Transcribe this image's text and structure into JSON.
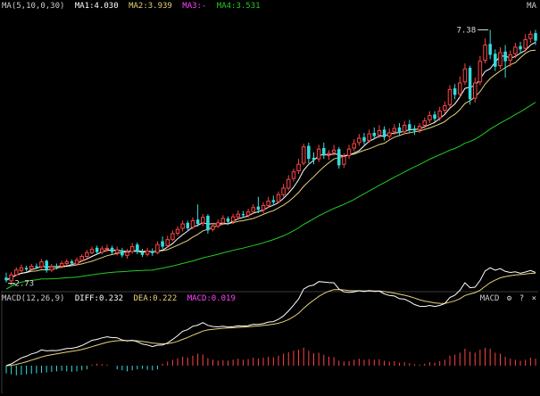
{
  "main_legend": {
    "label": "MA(5,10,0,30)",
    "ma1": "MA1:4.030",
    "ma2": "MA2:3.939",
    "ma3": "MA3:-",
    "ma4": "MA4:3.531",
    "right_tag": "MA"
  },
  "macd_legend": {
    "label": "MACD(12,26,9)",
    "diff": "DIFF:0.232",
    "dea": "DEA:0.222",
    "macd": "MACD:0.019",
    "right_tag": "MACD"
  },
  "colors": {
    "background": "#000000",
    "up": "#ff4444",
    "down": "#33dddd",
    "ma1": "#ffffff",
    "ma2": "#e8d27a",
    "ma3": "#ff44ff",
    "ma4": "#22cc22",
    "diff": "#ffffff",
    "dea": "#e8d27a",
    "macd_label": "#ff44ff",
    "grid": "#333333"
  },
  "icons": [
    "gear-icon",
    "help-icon",
    "close-icon"
  ],
  "chart_data": {
    "type": "candlestick",
    "price_range": [
      2.6,
      7.7
    ],
    "annotations": {
      "high": "7.38",
      "low": "2.73"
    },
    "candles": [
      [
        2.81,
        2.76,
        2.9,
        2.72
      ],
      [
        2.75,
        2.86,
        2.91,
        2.73
      ],
      [
        2.86,
        2.95,
        3.0,
        2.84
      ],
      [
        2.94,
        2.99,
        3.05,
        2.91
      ],
      [
        2.99,
        2.96,
        3.03,
        2.92
      ],
      [
        2.97,
        3.02,
        3.06,
        2.94
      ],
      [
        3.02,
        3.0,
        3.07,
        2.96
      ],
      [
        3.01,
        3.1,
        3.15,
        2.98
      ],
      [
        3.12,
        2.94,
        3.14,
        2.9
      ],
      [
        2.95,
        3.01,
        3.06,
        2.91
      ],
      [
        3.01,
        3.0,
        3.07,
        2.96
      ],
      [
        3.02,
        3.07,
        3.12,
        2.98
      ],
      [
        3.07,
        3.1,
        3.15,
        3.03
      ],
      [
        3.11,
        3.07,
        3.14,
        3.02
      ],
      [
        3.06,
        3.13,
        3.18,
        3.03
      ],
      [
        3.13,
        3.2,
        3.24,
        3.1
      ],
      [
        3.2,
        3.27,
        3.32,
        3.17
      ],
      [
        3.27,
        3.33,
        3.38,
        3.24
      ],
      [
        3.36,
        3.28,
        3.4,
        3.23
      ],
      [
        3.28,
        3.34,
        3.39,
        3.24
      ],
      [
        3.34,
        3.35,
        3.42,
        3.3
      ],
      [
        3.36,
        3.28,
        3.4,
        3.24
      ],
      [
        3.27,
        3.32,
        3.38,
        3.22
      ],
      [
        3.31,
        3.22,
        3.36,
        3.18
      ],
      [
        3.22,
        3.28,
        3.34,
        3.16
      ],
      [
        3.29,
        3.38,
        3.45,
        3.25
      ],
      [
        3.42,
        3.28,
        3.46,
        3.24
      ],
      [
        3.28,
        3.23,
        3.34,
        3.19
      ],
      [
        3.24,
        3.3,
        3.36,
        3.2
      ],
      [
        3.3,
        3.26,
        3.35,
        3.21
      ],
      [
        3.27,
        3.42,
        3.48,
        3.24
      ],
      [
        3.48,
        3.38,
        3.57,
        3.34
      ],
      [
        3.4,
        3.51,
        3.58,
        3.36
      ],
      [
        3.51,
        3.62,
        3.68,
        3.48
      ],
      [
        3.63,
        3.7,
        3.76,
        3.58
      ],
      [
        3.72,
        3.8,
        3.86,
        3.66
      ],
      [
        3.82,
        3.72,
        3.86,
        3.66
      ],
      [
        3.74,
        3.86,
        3.92,
        3.7
      ],
      [
        3.88,
        3.8,
        4.16,
        3.75
      ],
      [
        3.82,
        3.92,
        3.98,
        3.76
      ],
      [
        3.95,
        3.68,
        3.98,
        3.62
      ],
      [
        3.7,
        3.76,
        3.82,
        3.66
      ],
      [
        3.76,
        3.82,
        3.88,
        3.72
      ],
      [
        3.82,
        3.9,
        3.96,
        3.78
      ],
      [
        3.9,
        3.84,
        3.94,
        3.78
      ],
      [
        3.85,
        3.93,
        3.99,
        3.8
      ],
      [
        3.93,
        3.98,
        4.05,
        3.89
      ],
      [
        3.98,
        3.96,
        4.04,
        3.91
      ],
      [
        3.96,
        4.02,
        4.08,
        3.92
      ],
      [
        4.03,
        4.1,
        4.16,
        3.98
      ],
      [
        4.12,
        4.06,
        4.3,
        4.0
      ],
      [
        4.06,
        4.14,
        4.2,
        4.0
      ],
      [
        4.14,
        4.22,
        4.3,
        4.1
      ],
      [
        4.24,
        4.2,
        4.32,
        4.14
      ],
      [
        4.21,
        4.34,
        4.4,
        4.18
      ],
      [
        4.34,
        4.46,
        4.54,
        4.3
      ],
      [
        4.46,
        4.62,
        4.7,
        4.42
      ],
      [
        4.64,
        4.76,
        4.82,
        4.58
      ],
      [
        4.78,
        4.9,
        5.0,
        4.72
      ],
      [
        4.92,
        5.22,
        5.28,
        4.88
      ],
      [
        5.24,
        5.0,
        5.3,
        4.92
      ],
      [
        5.02,
        4.98,
        5.12,
        4.9
      ],
      [
        5.0,
        5.18,
        5.26,
        4.94
      ],
      [
        5.2,
        5.06,
        5.3,
        5.0
      ],
      [
        5.08,
        5.1,
        5.16,
        4.98
      ],
      [
        5.12,
        5.16,
        5.26,
        5.06
      ],
      [
        5.18,
        4.88,
        5.22,
        4.82
      ],
      [
        4.9,
        5.04,
        5.1,
        4.84
      ],
      [
        5.06,
        5.18,
        5.26,
        5.0
      ],
      [
        5.2,
        5.28,
        5.36,
        5.14
      ],
      [
        5.3,
        5.38,
        5.46,
        5.24
      ],
      [
        5.4,
        5.32,
        5.48,
        5.26
      ],
      [
        5.34,
        5.46,
        5.54,
        5.3
      ],
      [
        5.48,
        5.42,
        5.58,
        5.36
      ],
      [
        5.44,
        5.52,
        5.62,
        5.38
      ],
      [
        5.54,
        5.4,
        5.6,
        5.34
      ],
      [
        5.42,
        5.48,
        5.56,
        5.36
      ],
      [
        5.5,
        5.56,
        5.64,
        5.44
      ],
      [
        5.58,
        5.48,
        5.66,
        5.42
      ],
      [
        5.5,
        5.62,
        5.7,
        5.46
      ],
      [
        5.64,
        5.54,
        5.72,
        5.48
      ],
      [
        5.56,
        5.52,
        5.62,
        5.44
      ],
      [
        5.54,
        5.6,
        5.66,
        5.48
      ],
      [
        5.62,
        5.7,
        5.76,
        5.56
      ],
      [
        5.72,
        5.8,
        5.88,
        5.66
      ],
      [
        5.82,
        5.74,
        5.88,
        5.68
      ],
      [
        5.76,
        5.88,
        5.96,
        5.7
      ],
      [
        5.9,
        5.98,
        6.06,
        5.84
      ],
      [
        6.0,
        6.28,
        6.36,
        5.96
      ],
      [
        6.3,
        6.18,
        6.38,
        6.1
      ],
      [
        6.2,
        6.4,
        6.52,
        6.14
      ],
      [
        6.42,
        6.66,
        6.76,
        6.36
      ],
      [
        6.68,
        6.1,
        6.72,
        6.0
      ],
      [
        6.12,
        6.4,
        6.5,
        6.04
      ],
      [
        6.42,
        6.8,
        6.9,
        6.36
      ],
      [
        6.82,
        7.1,
        7.22,
        6.76
      ],
      [
        7.12,
        6.92,
        7.38,
        6.84
      ],
      [
        6.94,
        6.7,
        7.02,
        6.62
      ],
      [
        6.72,
        6.96,
        7.06,
        6.66
      ],
      [
        6.98,
        6.8,
        7.1,
        6.5
      ],
      [
        6.82,
        6.92,
        7.0,
        6.7
      ],
      [
        6.94,
        7.06,
        7.14,
        6.86
      ],
      [
        7.08,
        7.02,
        7.16,
        6.94
      ],
      [
        7.04,
        7.2,
        7.3,
        6.98
      ],
      [
        7.22,
        7.3,
        7.36,
        7.14
      ],
      [
        7.32,
        7.18,
        7.38,
        7.1
      ]
    ],
    "macd_hist": [
      -0.01,
      -0.012,
      -0.014,
      -0.013,
      -0.012,
      -0.011,
      -0.01,
      -0.009,
      -0.008,
      -0.007,
      -0.006,
      -0.005,
      -0.006,
      -0.007,
      -0.006,
      -0.004,
      -0.002,
      0.002,
      0.004,
      0.003,
      0.002,
      0.0,
      -0.002,
      -0.004,
      -0.006,
      -0.004,
      -0.002,
      -0.001,
      -0.003,
      -0.004,
      -0.002,
      0.004,
      0.008,
      0.012,
      0.015,
      0.018,
      0.016,
      0.02,
      0.024,
      0.022,
      0.015,
      0.012,
      0.01,
      0.011,
      0.01,
      0.012,
      0.014,
      0.012,
      0.013,
      0.016,
      0.014,
      0.016,
      0.018,
      0.017,
      0.02,
      0.024,
      0.027,
      0.03,
      0.032,
      0.036,
      0.03,
      0.025,
      0.026,
      0.022,
      0.018,
      0.017,
      0.01,
      0.008,
      0.009,
      0.012,
      0.014,
      0.012,
      0.013,
      0.012,
      0.013,
      0.01,
      0.008,
      0.009,
      0.006,
      0.007,
      0.005,
      0.003,
      0.002,
      0.004,
      0.007,
      0.006,
      0.009,
      0.012,
      0.02,
      0.022,
      0.026,
      0.034,
      0.028,
      0.026,
      0.032,
      0.036,
      0.034,
      0.026,
      0.024,
      0.018,
      0.014,
      0.012,
      0.01,
      0.012,
      0.016,
      0.014
    ],
    "macd_range": [
      -0.05,
      0.3
    ],
    "hist_range": [
      -0.05,
      0.05
    ]
  }
}
